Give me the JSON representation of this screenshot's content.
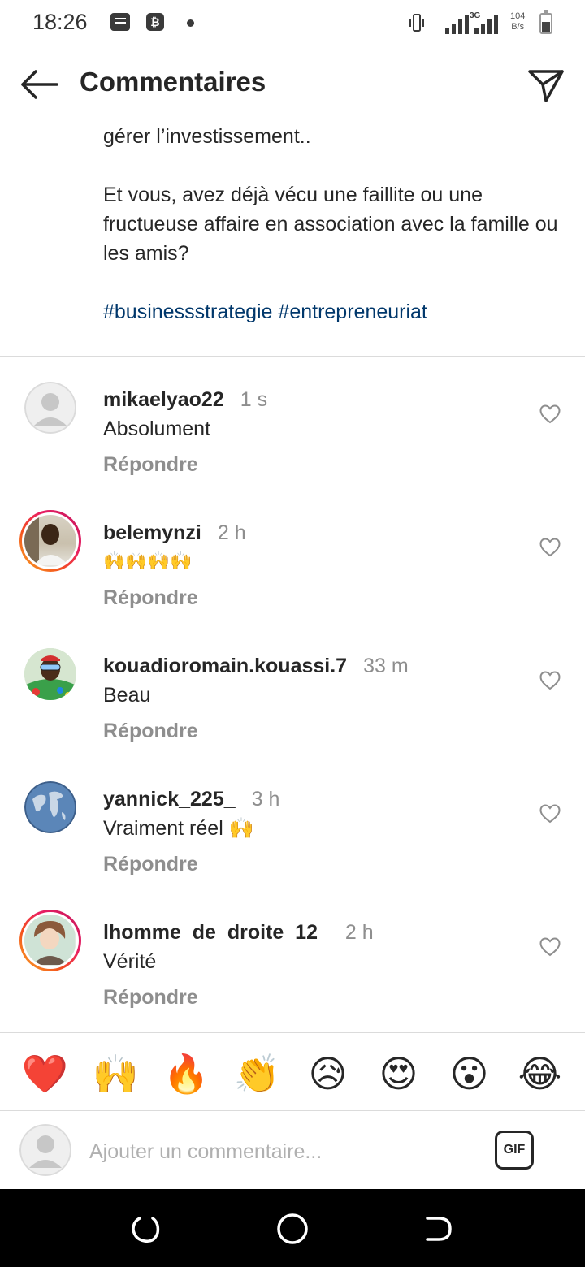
{
  "status_bar": {
    "time": "18:26",
    "network": "3G",
    "speed_value": "104",
    "speed_unit": "B/s"
  },
  "header": {
    "title": "Commentaires"
  },
  "caption": {
    "line1": "gérer l’investissement..",
    "question": "Et vous, avez déjà vécu une faillite ou une fructueuse affaire en association avec la famille ou les amis?",
    "hashtags": [
      "#businessstrategie",
      "#entrepreneuriat"
    ]
  },
  "comments": [
    {
      "username": "mikaelyao22",
      "time": "1 s",
      "text": "Absolument",
      "reply_label": "Répondre",
      "avatar": "default"
    },
    {
      "username": "belemynzi",
      "time": "2 h",
      "text": "🙌🙌🙌🙌",
      "reply_label": "Répondre",
      "avatar": "photo"
    },
    {
      "username": "kouadioromain.kouassi.7",
      "time": "33 m",
      "text": "Beau",
      "reply_label": "Répondre",
      "avatar": "photo"
    },
    {
      "username": "yannick_225_",
      "time": "3 h",
      "text": "Vraiment réel 🙌",
      "reply_label": "Répondre",
      "avatar": "globe"
    },
    {
      "username": "lhomme_de_droite_12_",
      "time": "2 h",
      "text": "Vérité",
      "reply_label": "Répondre",
      "avatar": "anime"
    }
  ],
  "reactions": [
    "❤️",
    "🙌",
    "🔥",
    "👏",
    "😥",
    "😍",
    "😮",
    "😂"
  ],
  "add_comment": {
    "placeholder": "Ajouter un commentaire...",
    "gif_label": "GIF"
  },
  "colors": {
    "hashtag": "#00376b",
    "secondary_text": "#8e8e8e",
    "divider": "#dbdbdb",
    "story_ring": "#e91e63"
  }
}
